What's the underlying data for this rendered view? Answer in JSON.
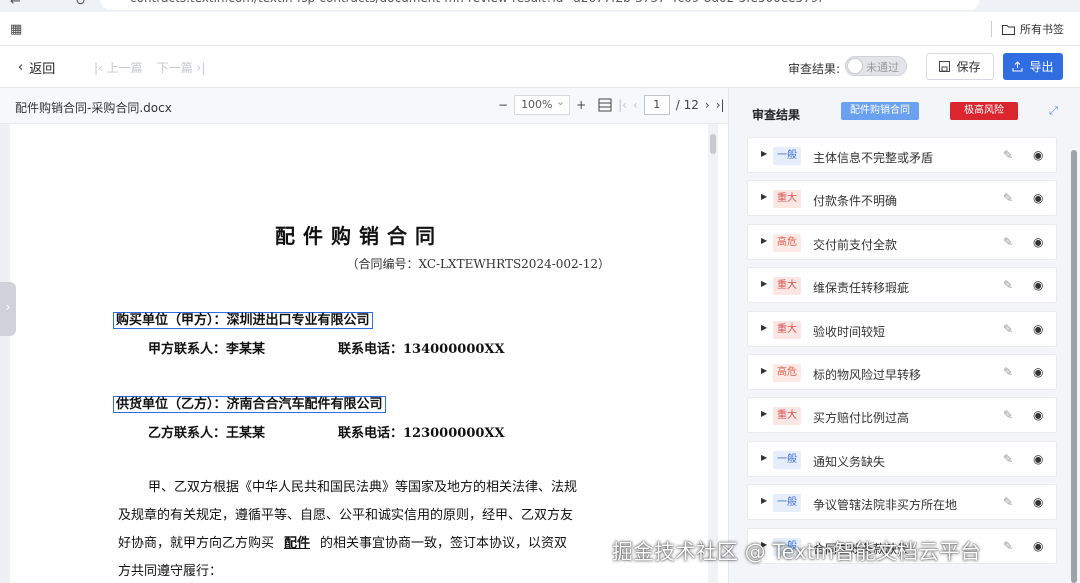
{
  "browser": {
    "url": "contracts.textin.com/textin-fsp-contracts/document-mh-review-result?id=a2677f2b-3737-4c69-8d02-5fe500ee579f",
    "bookmarks_label": "所有书签"
  },
  "toolbar": {
    "back_label": "返回",
    "prev_label": "上一篇",
    "next_label": "下一篇",
    "review_result_label": "审查结果:",
    "toggle_text": "未通过",
    "save_label": "保存",
    "export_label": "导出"
  },
  "document": {
    "file_name": "配件购销合同-采购合同.docx",
    "zoom": "100%",
    "current_page": "1",
    "total_pages": "/ 12",
    "title": "配件购销合同",
    "contract_number": "（合同编号：XC-LXTEWHRTS2024-002-12）",
    "buyer_line": "购买单位（甲方）：深圳进出口专业有限公司",
    "buyer_contact": "甲方联系人：李某某",
    "buyer_phone": "联系电话：134000000XX",
    "supplier_line": "供货单位（乙方）：济南合合汽车配件有限公司",
    "supplier_contact": "乙方联系人：王某某",
    "supplier_phone": "联系电话：123000000XX",
    "para_line1": "甲、乙双方根据《中华人民共和国民法典》等国家及地方的相关法律、法规",
    "para_line2": "及规章的有关规定，遵循平等、自愿、公平和诚实信用的原则，经甲、乙双方友",
    "para_line3_a": "好协商，就甲方向乙方购买",
    "para_line3_goods": "配件",
    "para_line3_b": "的相关事宜协商一致，签订本协议，以资双",
    "para_line4": "方共同遵守履行："
  },
  "review_panel": {
    "title": "审查结果",
    "tag_blue": "配件购销合同",
    "tag_red": "极高风险",
    "items": [
      {
        "level": "一般",
        "level_type": "normal",
        "title": "主体信息不完整或矛盾"
      },
      {
        "level": "重大",
        "level_type": "major",
        "title": "付款条件不明确"
      },
      {
        "level": "高危",
        "level_type": "high",
        "title": "交付前支付全款"
      },
      {
        "level": "重大",
        "level_type": "major",
        "title": "维保责任转移瑕疵"
      },
      {
        "level": "重大",
        "level_type": "major",
        "title": "验收时间较短"
      },
      {
        "level": "高危",
        "level_type": "high",
        "title": "标的物风险过早转移"
      },
      {
        "level": "重大",
        "level_type": "major",
        "title": "买方赔付比例过高"
      },
      {
        "level": "一般",
        "level_type": "normal",
        "title": "通知义务缺失"
      },
      {
        "level": "一般",
        "level_type": "normal",
        "title": "争议管辖法院非买方所在地"
      },
      {
        "level": "一般",
        "level_type": "normal",
        "title": "合同生效条款缺失"
      }
    ]
  },
  "watermark": "掘金技术社区 @ Textin智能文档云平台",
  "colors": {
    "primary": "#2f6de0",
    "danger": "#d9262f",
    "tag_blue": "#6aa0f0"
  }
}
